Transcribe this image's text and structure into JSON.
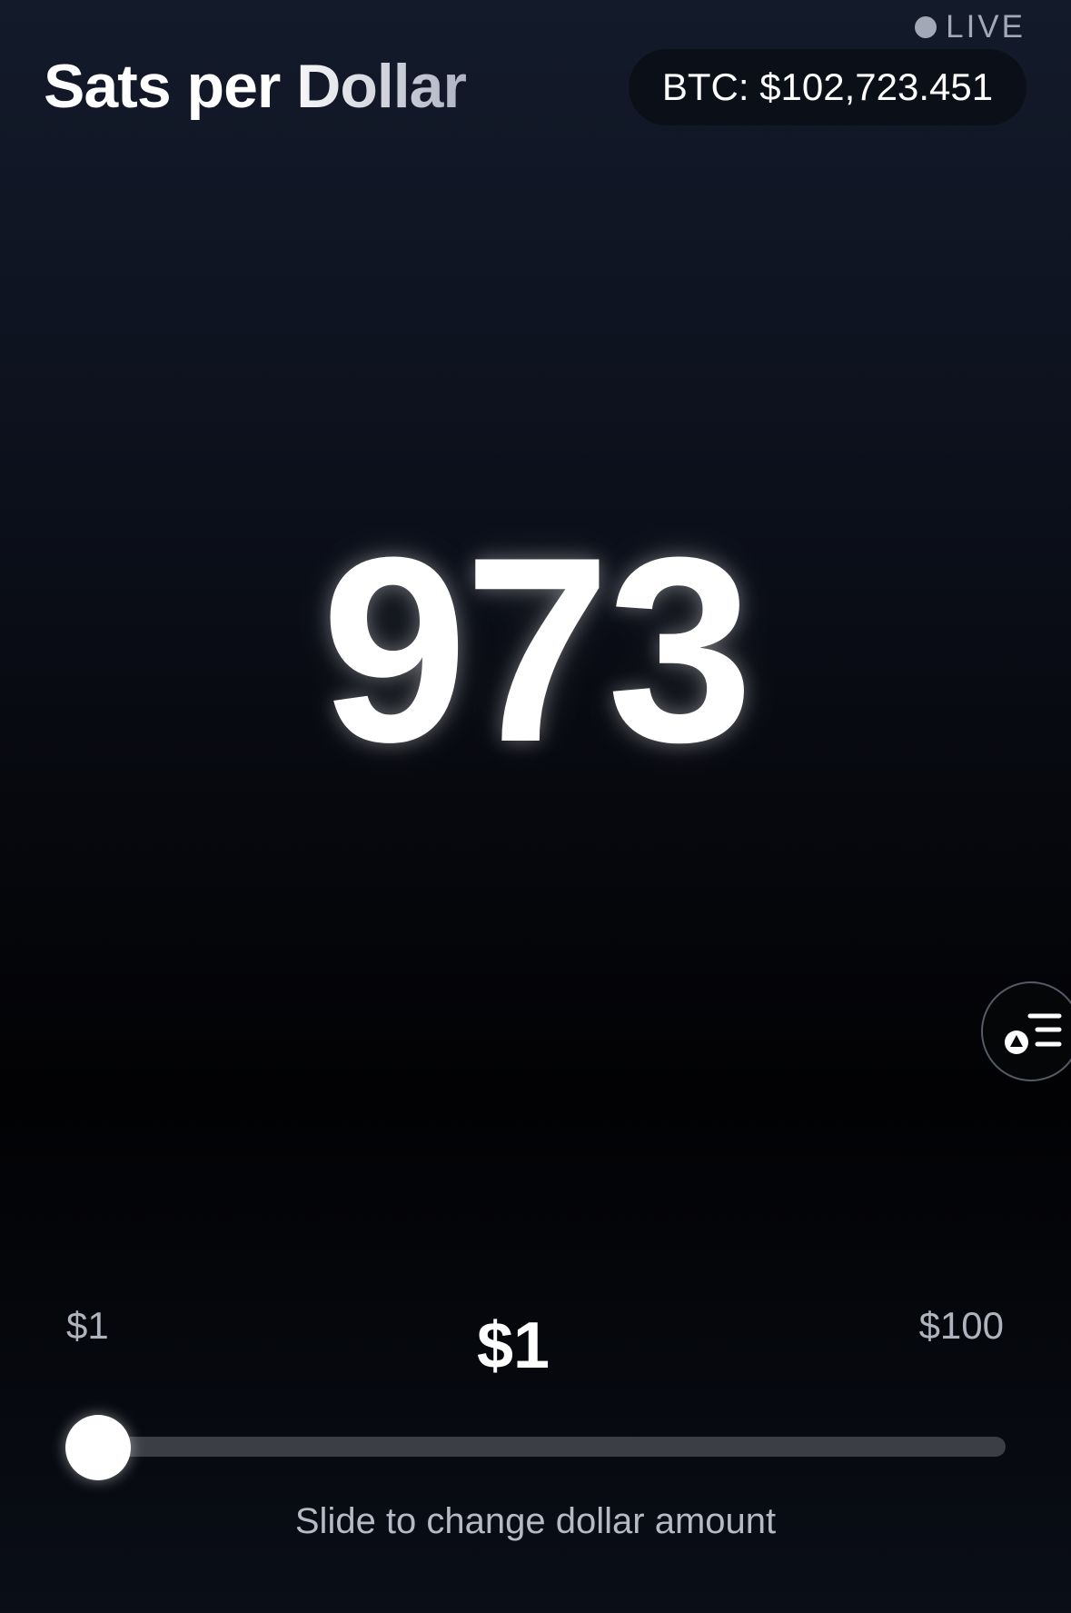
{
  "status": {
    "live_label": "LIVE"
  },
  "header": {
    "title": "Sats per Dollar",
    "btc_price_label": "BTC: $102,723.451"
  },
  "main": {
    "sats_value": "973"
  },
  "slider": {
    "min_label": "$1",
    "max_label": "$100",
    "current_label": "$1",
    "current_value": 1,
    "min_value": 1,
    "max_value": 100,
    "hint": "Slide to change dollar amount"
  },
  "side_button": {
    "icon": "shapes-list-icon"
  },
  "colors": {
    "background_top": "#131a2a",
    "background_mid": "#020204",
    "accent_text": "#ffffff",
    "muted_text": "#a2a8b6",
    "slider_track": "#3b3e44"
  }
}
